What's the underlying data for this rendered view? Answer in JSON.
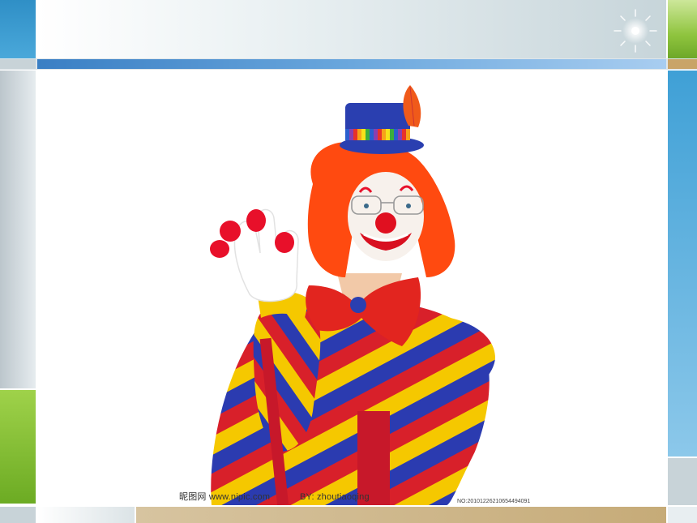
{
  "slide": {
    "watermark_left": "昵图网 www.nipic.com",
    "watermark_author": "BY: zhoutiaoqing",
    "watermark_id": "NO:20101226210654494091"
  },
  "image": {
    "subject": "clown-photo",
    "colors": {
      "wig": "#ff4a10",
      "hat": "#2a3fb0",
      "stripe_red": "#d8202a",
      "stripe_yellow": "#f5c800",
      "stripe_blue": "#2b3bb0",
      "bowtie": "#e2251f",
      "glove": "#ffffff",
      "nose": "#e01020"
    }
  }
}
